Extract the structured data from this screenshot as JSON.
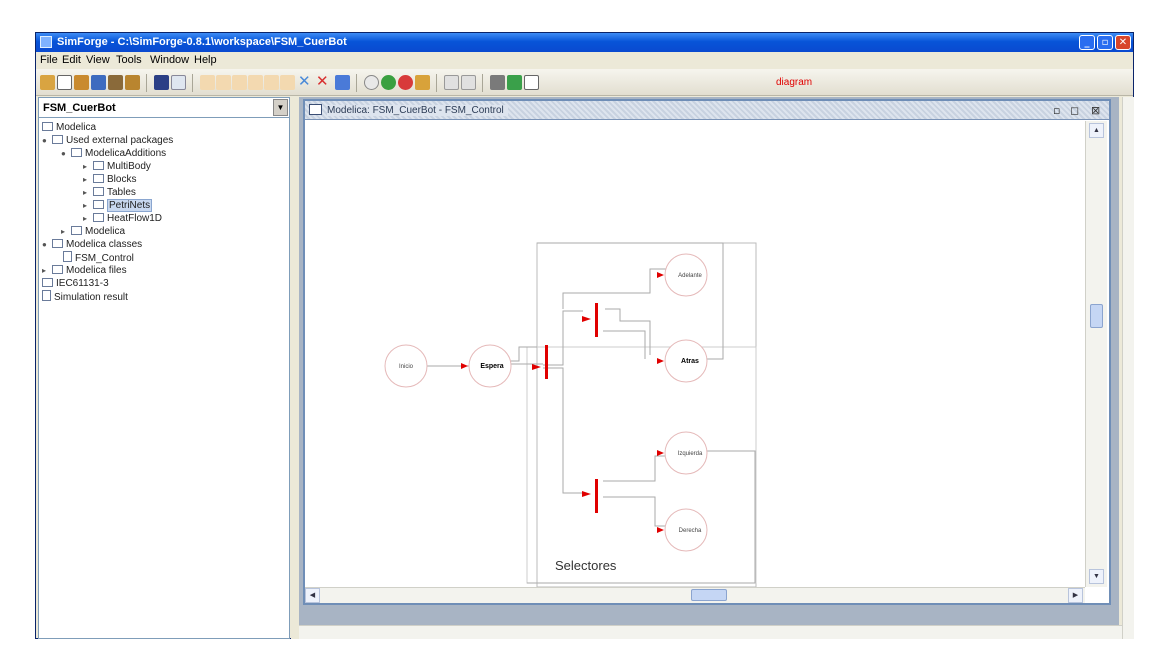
{
  "window": {
    "title": "SimForge - C:\\SimForge-0.8.1\\workspace\\FSM_CuerBot",
    "controls": {
      "minimize": "_",
      "maximize": "▫",
      "close": "✕"
    }
  },
  "menubar": [
    "File",
    "Edit",
    "View",
    "Tools",
    "Window",
    "Help"
  ],
  "toolbar": {
    "label": "diagram",
    "accent_color": "#e00000"
  },
  "sidebar": {
    "project": "FSM_CuerBot",
    "tree": [
      {
        "label": "Modelica",
        "icon": "folder-icon"
      },
      {
        "label": "Used external packages",
        "icon": "folder-icon"
      },
      {
        "label": "ModelicaAdditions",
        "icon": "folder-icon"
      },
      {
        "label": "MultiBody",
        "icon": "folder-icon"
      },
      {
        "label": "Blocks",
        "icon": "folder-icon"
      },
      {
        "label": "Tables",
        "icon": "folder-icon"
      },
      {
        "label": "PetriNets",
        "icon": "folder-icon"
      },
      {
        "label": "HeatFlow1D",
        "icon": "folder-icon"
      },
      {
        "label": "Modelica",
        "icon": "folder-icon"
      },
      {
        "label": "Modelica classes",
        "icon": "folder-icon"
      },
      {
        "label": "FSM_Control",
        "icon": "document-icon"
      },
      {
        "label": "Modelica files",
        "icon": "folder-icon"
      },
      {
        "label": "IEC61131-3",
        "icon": "folder-icon"
      },
      {
        "label": "Simulation result",
        "icon": "document-icon"
      }
    ]
  },
  "editor": {
    "title": "Modelica: FSM_CuerBot - FSM_Control",
    "controls": {
      "iconify": "▫",
      "restore": "◻",
      "close": "⊠"
    }
  },
  "diagram": {
    "group_label": "Selectores",
    "states": {
      "inicio": "Inicio",
      "espera": "Espera",
      "adelante": "Adelante",
      "atras": "Atras",
      "izquierda": "Izquierda",
      "derecha": "Derecha"
    },
    "colors": {
      "transition": "#e00000",
      "line": "#aaaaaa"
    }
  }
}
